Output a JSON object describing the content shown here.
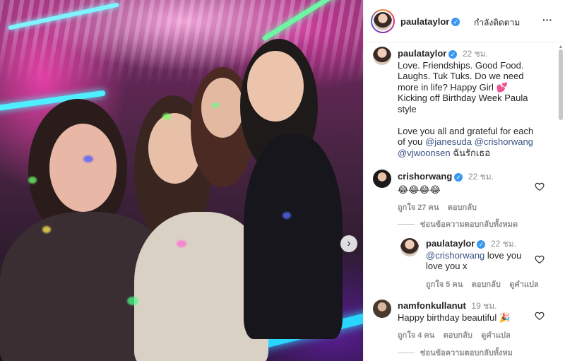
{
  "post": {
    "author": "paulataylor",
    "follow_label": "กำลังติดตาม",
    "more_label": "···"
  },
  "caption": {
    "author": "paulataylor",
    "time": "22 ชม.",
    "line1": "Love. Friendships. Good Food.",
    "line2": "Laughs. Tuk Tuks. Do we need",
    "line3": "more in life? Happy Girl 💕",
    "line4": "Kicking off Birthday Week Paula",
    "line5": "style",
    "line6": "Love you all and grateful for each",
    "line7_prefix": "of you ",
    "mention1": "@janesuda",
    "mention2": "@crishorwang",
    "mention3": "@vjwoonsen",
    "line8_suffix": " ฉันรักเธอ"
  },
  "comments": [
    {
      "author": "crishorwang",
      "time": "22 ชม.",
      "text": "😂😂😂😂",
      "likes": "ถูกใจ 27 คน",
      "reply_label": "ตอบกลับ"
    },
    {
      "hide_replies": "ซ่อนข้อความตอบกลับทั้งหมด"
    },
    {
      "author": "paulataylor",
      "time": "22 ชม.",
      "mention": "@crishorwang",
      "text1": " love you",
      "text2": "love you x",
      "likes": "ถูกใจ 5 คน",
      "reply_label": "ตอบกลับ",
      "translate_label": "ดูคำแปล"
    },
    {
      "author": "namfonkullanut",
      "time": "19 ชม.",
      "text": "Happy birthday beautiful 🎉",
      "likes": "ถูกใจ 4 คน",
      "reply_label": "ตอบกลับ",
      "translate_label": "ดูคำแปล"
    },
    {
      "hide_replies": "ซ่อนข้อความตอบกลับทั้งหม"
    }
  ],
  "carousel": {
    "next_icon": "chevron-right-icon",
    "next_glyph": "›"
  },
  "colors": {
    "link": "#385185",
    "verified": "#3897f0",
    "muted": "#8e8e8e"
  }
}
